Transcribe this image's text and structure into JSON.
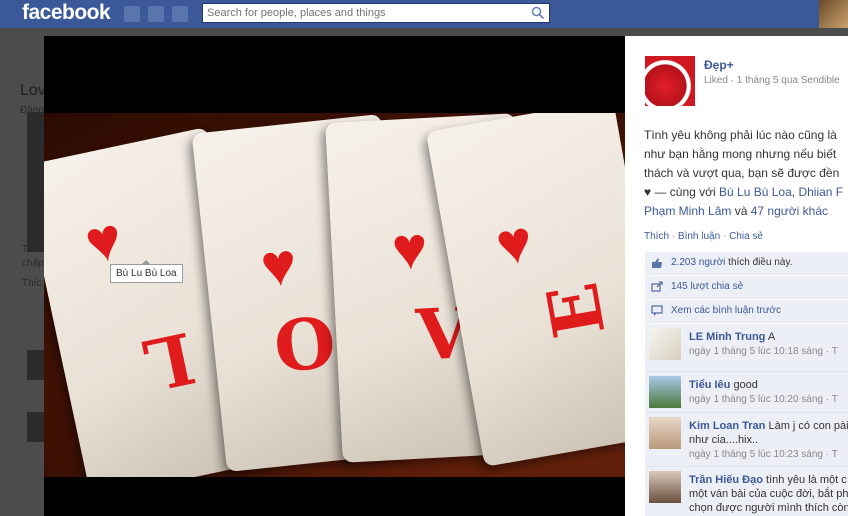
{
  "topbar": {
    "logo": "facebook",
    "search_placeholder": "Search for people, places and things"
  },
  "background_page": {
    "title": "Lov",
    "subtitle": "Đăng",
    "text_lines": [
      "Tình",
      "chấp",
      "Thíc"
    ]
  },
  "photo": {
    "cards": [
      "L",
      "O",
      "V",
      "E"
    ],
    "tag": "Bù Lu Bù Loa"
  },
  "panel": {
    "album_name": "Đẹp+",
    "album_meta": "Liked · 1 tháng 5 qua Sendible",
    "caption": {
      "line1": "Tình yêu không phải lúc nào cũng là",
      "line2": "như bạn hằng mong nhưng nếu biết",
      "line3": "thách và vượt qua, bạn sẽ được đền",
      "line4_prefix": "♥ — cùng với ",
      "tagged1": "Bù Lu Bù Loa",
      "separator": ", ",
      "tagged2": "Dhiian F",
      "tagged3": "Phạm Minh Lâm",
      "and_text": " và ",
      "others": "47 người khác"
    },
    "actions": {
      "like": "Thích",
      "comment": "Bình luận",
      "share": "Chia sẻ",
      "dot": " · "
    },
    "likes": {
      "count_link": "2.203 người",
      "suffix": " thích điều này."
    },
    "shares": "145 lượt chia sẻ",
    "view_previous": "Xem các bình luận trước",
    "comments": [
      {
        "name": "LE Minh Trung",
        "text": "A",
        "text2": "",
        "time": "ngày 1 tháng 5 lúc 10:18 sáng · T"
      },
      {
        "name": "Tiểu Iêu",
        "text": "good",
        "text2": "",
        "time": "ngày 1 tháng 5 lúc 10:20 sáng · T"
      },
      {
        "name": "Kim Loan Tran",
        "text": "Làm j có con pài",
        "text2": "như cia....hix..",
        "time": "ngày 1 tháng 5 lúc 10:23 sáng · T"
      },
      {
        "name": "Trần Hiếu Đạo",
        "text": "tình yêu là một c",
        "text2": "một ván bài của cuộc đời, bắt phả",
        "text3": "chọn được người mình thích còn b"
      }
    ]
  },
  "colors": {
    "facebook_blue": "#3b5998",
    "link": "#3b5998",
    "panel_bg": "#eceff5",
    "heart_red": "#e01b1b"
  },
  "icons": [
    "search-icon",
    "like-icon",
    "share-icon",
    "comment-icon"
  ]
}
